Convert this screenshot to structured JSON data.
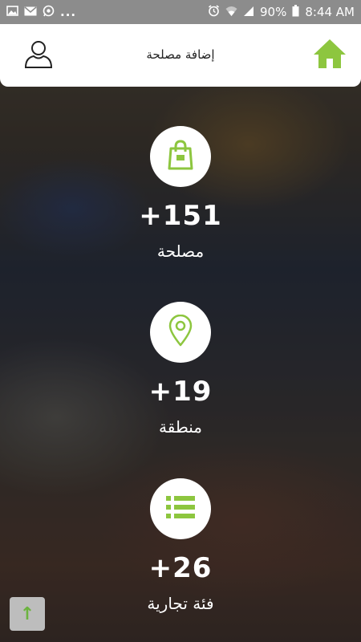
{
  "status_bar": {
    "icons_left": [
      "image-icon",
      "mail-icon",
      "whatsapp-icon"
    ],
    "overflow": "...",
    "icons_right": [
      "alarm-icon",
      "wifi-icon",
      "signal-icon",
      "battery-icon"
    ],
    "battery": "90%",
    "time": "8:44 AM"
  },
  "appbar": {
    "title": "إضافة مصلحة",
    "left_icon": "user-icon",
    "right_icon": "home-icon",
    "accent": "#8dc63f"
  },
  "stats": [
    {
      "icon": "shopping-bag-icon",
      "value": "+151",
      "label": "مصلحة"
    },
    {
      "icon": "location-pin-icon",
      "value": "+19",
      "label": "منطقة"
    },
    {
      "icon": "list-icon",
      "value": "+26",
      "label": "فئة تجارية"
    }
  ],
  "scroll_top": {
    "icon": "arrow-up-icon",
    "glyph": "↑"
  }
}
